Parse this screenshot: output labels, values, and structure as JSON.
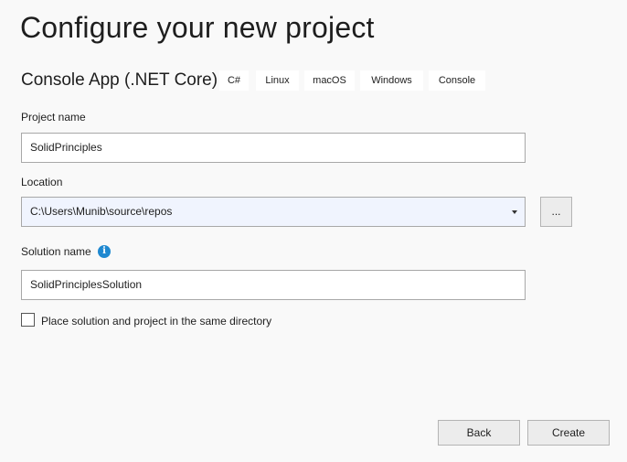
{
  "title": "Configure your new project",
  "template": {
    "name": "Console App (.NET Core)",
    "tags": [
      "C#",
      "Linux",
      "macOS",
      "Windows",
      "Console"
    ]
  },
  "project_name": {
    "label": "Project name",
    "value": "SolidPrinciples"
  },
  "location": {
    "label": "Location",
    "value": "C:\\Users\\Munib\\source\\repos",
    "browse_label": "..."
  },
  "solution_name": {
    "label": "Solution name",
    "value": "SolidPrinciplesSolution",
    "info_icon": "i"
  },
  "same_directory": {
    "label": "Place solution and project in the same directory",
    "checked": false
  },
  "buttons": {
    "back": "Back",
    "create": "Create"
  }
}
